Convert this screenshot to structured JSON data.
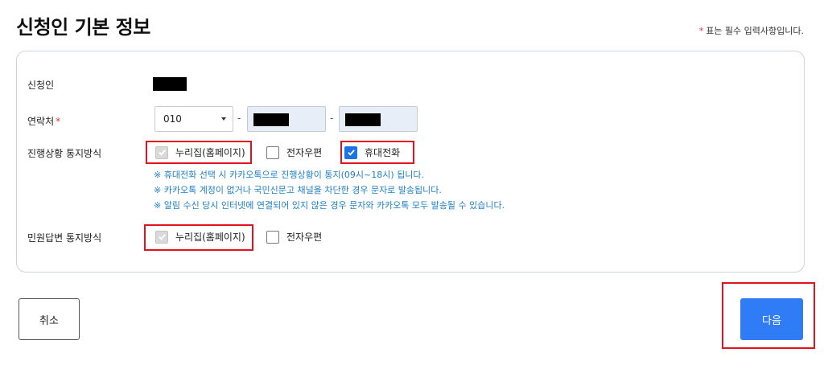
{
  "page": {
    "title": "신청인 기본 정보",
    "required_note_star": "*",
    "required_note": "표는 필수 입력사항입니다."
  },
  "applicant": {
    "label": "신청인",
    "value": ""
  },
  "contact": {
    "label": "연락처",
    "required_star": "*",
    "prefix_selected": "010",
    "separator": "-",
    "middle_value": "",
    "last_value": ""
  },
  "progress_notify": {
    "label": "진행상황 통지방식",
    "options": [
      {
        "label": "누리집(홈페이지)",
        "checked": true,
        "disabled": true
      },
      {
        "label": "전자우편",
        "checked": false,
        "disabled": false
      },
      {
        "label": "휴대전화",
        "checked": true,
        "disabled": false
      }
    ],
    "notes": [
      "※ 휴대전화 선택 시 카카오톡으로 진행상황이 통지(09시~18시) 됩니다.",
      "※ 카카오톡 계정이 없거나 국민신문고 채널을 차단한 경우 문자로 발송됩니다.",
      "※ 알림 수신 당시 인터넷에 연결되어 있지 않은 경우 문자와 카카오톡 모두 발송될 수 있습니다."
    ]
  },
  "reply_notify": {
    "label": "민원답변 통지방식",
    "options": [
      {
        "label": "누리집(홈페이지)",
        "checked": true,
        "disabled": true
      },
      {
        "label": "전자우편",
        "checked": false,
        "disabled": false
      }
    ]
  },
  "buttons": {
    "cancel": "취소",
    "next": "다음"
  },
  "colors": {
    "accent": "#2f7cf6",
    "required": "#e0393e",
    "note_text": "#1f80c6",
    "highlight": "#e0131f"
  },
  "icons": {
    "checkmark": "check-icon",
    "dropdown": "chevron-down-icon"
  }
}
